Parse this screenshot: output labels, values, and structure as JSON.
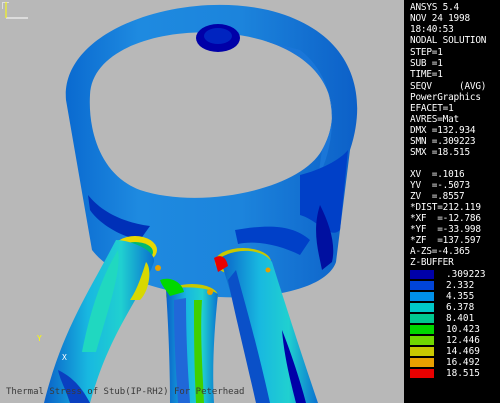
{
  "header": {
    "program": "ANSYS 5.4",
    "date": "NOV 24 1998",
    "time": "18:40:53",
    "solution": "NODAL SOLUTION",
    "step": "STEP=1",
    "sub": "SUB =1",
    "time_value": "TIME=1",
    "result": "SEQV     (AVG)",
    "graphics": "PowerGraphics",
    "efacet": "EFACET=1",
    "avres": "AVRES=Mat",
    "dmx": "DMX =132.934",
    "smn": "SMN =.309223",
    "smx": "SMX =18.515"
  },
  "view": {
    "xv": "XV  =.1016",
    "yv": "YV  =-.5073",
    "zv": "ZV  =.8557",
    "dist": "*DIST=212.119",
    "xf": "*XF  =-12.786",
    "yf": "*YF  =-33.998",
    "zf": "*ZF  =137.597",
    "azs": "A-ZS=-4.365",
    "zbuffer": "Z-BUFFER"
  },
  "legend": [
    {
      "value": ".309223",
      "color": "#0000a8"
    },
    {
      "value": "2.332",
      "color": "#0044d8"
    },
    {
      "value": "4.355",
      "color": "#0090e8"
    },
    {
      "value": "6.378",
      "color": "#00c8c8"
    },
    {
      "value": "8.401",
      "color": "#00c890"
    },
    {
      "value": "10.423",
      "color": "#00d800"
    },
    {
      "value": "12.446",
      "color": "#70d800"
    },
    {
      "value": "14.469",
      "color": "#c8c800"
    },
    {
      "value": "16.492",
      "color": "#e8a000"
    },
    {
      "value": "18.515",
      "color": "#e80000"
    }
  ],
  "caption": "Thermal Stress of Stub(IP-RH2) For Peterhead",
  "triad": {
    "x": "X",
    "y": "Y"
  }
}
